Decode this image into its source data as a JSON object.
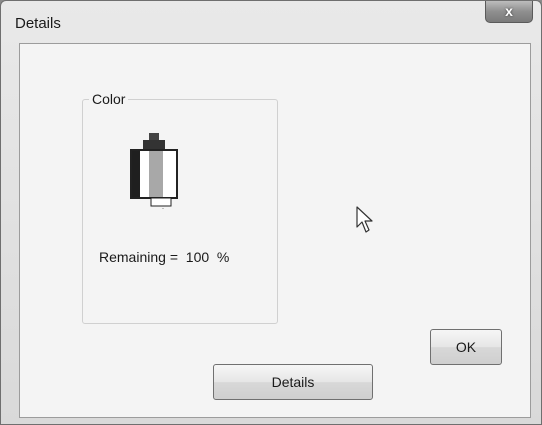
{
  "window": {
    "title": "Details",
    "close_glyph": "x"
  },
  "group": {
    "label": "Color",
    "cartridge_icon": "ink-cartridge-icon",
    "remaining_label": "Remaining =",
    "remaining_value": "100",
    "remaining_unit": "%"
  },
  "buttons": {
    "ok_label": "OK",
    "details_label": "Details"
  },
  "cursor_icon": "mouse-pointer-icon"
}
